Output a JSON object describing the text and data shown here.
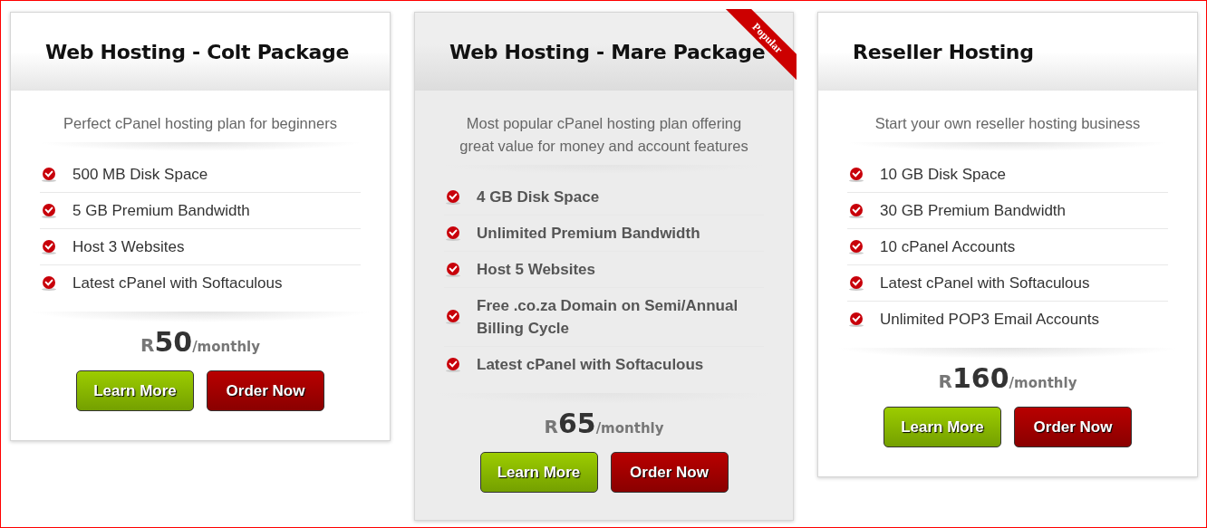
{
  "plans": [
    {
      "title": "Web Hosting - Colt Package",
      "featured": false,
      "description": "Perfect cPanel hosting plan for beginners",
      "features": [
        "500 MB Disk Space",
        "5 GB Premium Bandwidth",
        "Host 3 Websites",
        "Latest cPanel with Softaculous"
      ],
      "currency": "R",
      "amount": "50",
      "period": "/monthly",
      "buttons": [
        {
          "label": "Learn More",
          "kind": "secondary"
        },
        {
          "label": "Order Now",
          "kind": "primary"
        }
      ]
    },
    {
      "title": "Web Hosting - Mare Package",
      "featured": true,
      "ribbon": "Popular",
      "description": "Most popular cPanel hosting plan offering great value for money and account features",
      "features": [
        "4 GB Disk Space",
        "Unlimited Premium Bandwidth",
        "Host 5 Websites",
        "Free .co.za Domain on Semi/Annual Billing Cycle",
        "Latest cPanel with Softaculous"
      ],
      "currency": "R",
      "amount": "65",
      "period": "/monthly",
      "buttons": [
        {
          "label": "Learn More",
          "kind": "secondary"
        },
        {
          "label": "Order Now",
          "kind": "primary"
        }
      ]
    },
    {
      "title": "Reseller Hosting",
      "featured": false,
      "description": "Start your own reseller hosting business",
      "features": [
        "10 GB Disk Space",
        "30 GB Premium Bandwidth",
        "10 cPanel Accounts",
        "Latest cPanel with Softaculous",
        "Unlimited POP3 Email Accounts"
      ],
      "currency": "R",
      "amount": "160",
      "period": "/monthly",
      "buttons": [
        {
          "label": "Learn More",
          "kind": "secondary"
        },
        {
          "label": "Order Now",
          "kind": "primary"
        }
      ]
    }
  ]
}
